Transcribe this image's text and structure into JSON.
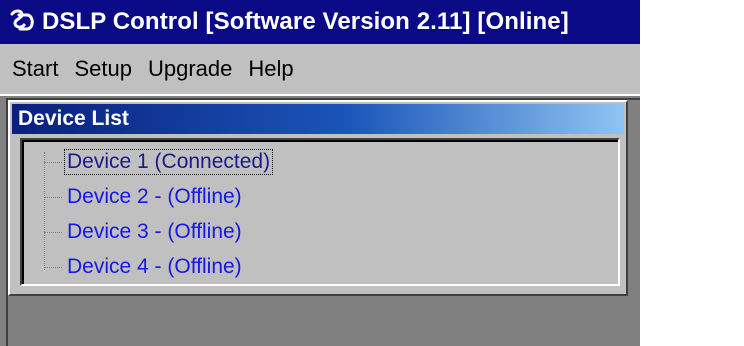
{
  "window": {
    "title": "DSLP Control [Software Version 2.11] [Online]",
    "icon": "dslp-app-icon",
    "colors": {
      "titlebar": "#0a0a86",
      "menubar": "#c0c0c0",
      "workspace": "#808080",
      "link": "#1717e6"
    }
  },
  "menu": {
    "items": [
      {
        "label": "Start"
      },
      {
        "label": "Setup"
      },
      {
        "label": "Upgrade"
      },
      {
        "label": "Help"
      }
    ]
  },
  "device_panel": {
    "title": "Device List",
    "devices": [
      {
        "label": "Device 1 (Connected)",
        "selected": true
      },
      {
        "label": "Device 2 -  (Offline)",
        "selected": false
      },
      {
        "label": "Device 3 -  (Offline)",
        "selected": false
      },
      {
        "label": "Device 4 -  (Offline)",
        "selected": false
      }
    ]
  }
}
